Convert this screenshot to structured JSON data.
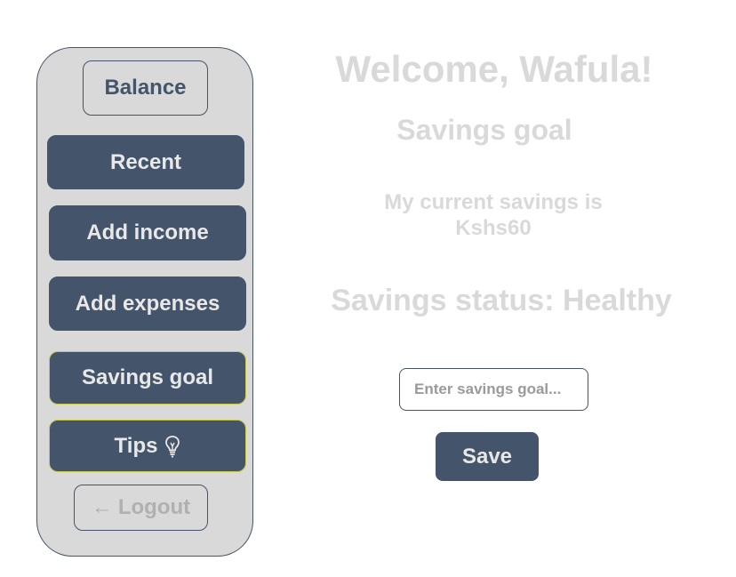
{
  "sidebar": {
    "balance_label": "Balance",
    "recent_label": "Recent",
    "add_income_label": "Add income",
    "add_expenses_label": "Add expenses",
    "savings_goal_label": "Savings goal",
    "tips_label": "Tips",
    "tips_icon": "lightbulb-icon",
    "logout_arrow": "←",
    "logout_label": "Logout"
  },
  "main": {
    "welcome": "Welcome, Wafula!",
    "section_title": "Savings goal",
    "current_savings_line1": "My current savings is",
    "current_savings_line2": "Kshs60",
    "status": "Savings status: Healthy",
    "goal_input_placeholder": "Enter savings goal...",
    "goal_input_value": "",
    "save_label": "Save"
  },
  "colors": {
    "primary": "#44546a",
    "sidebar_bg": "#d9d9d9",
    "highlight_border": "#c9c94a",
    "heading_text": "#d9d9d9"
  }
}
